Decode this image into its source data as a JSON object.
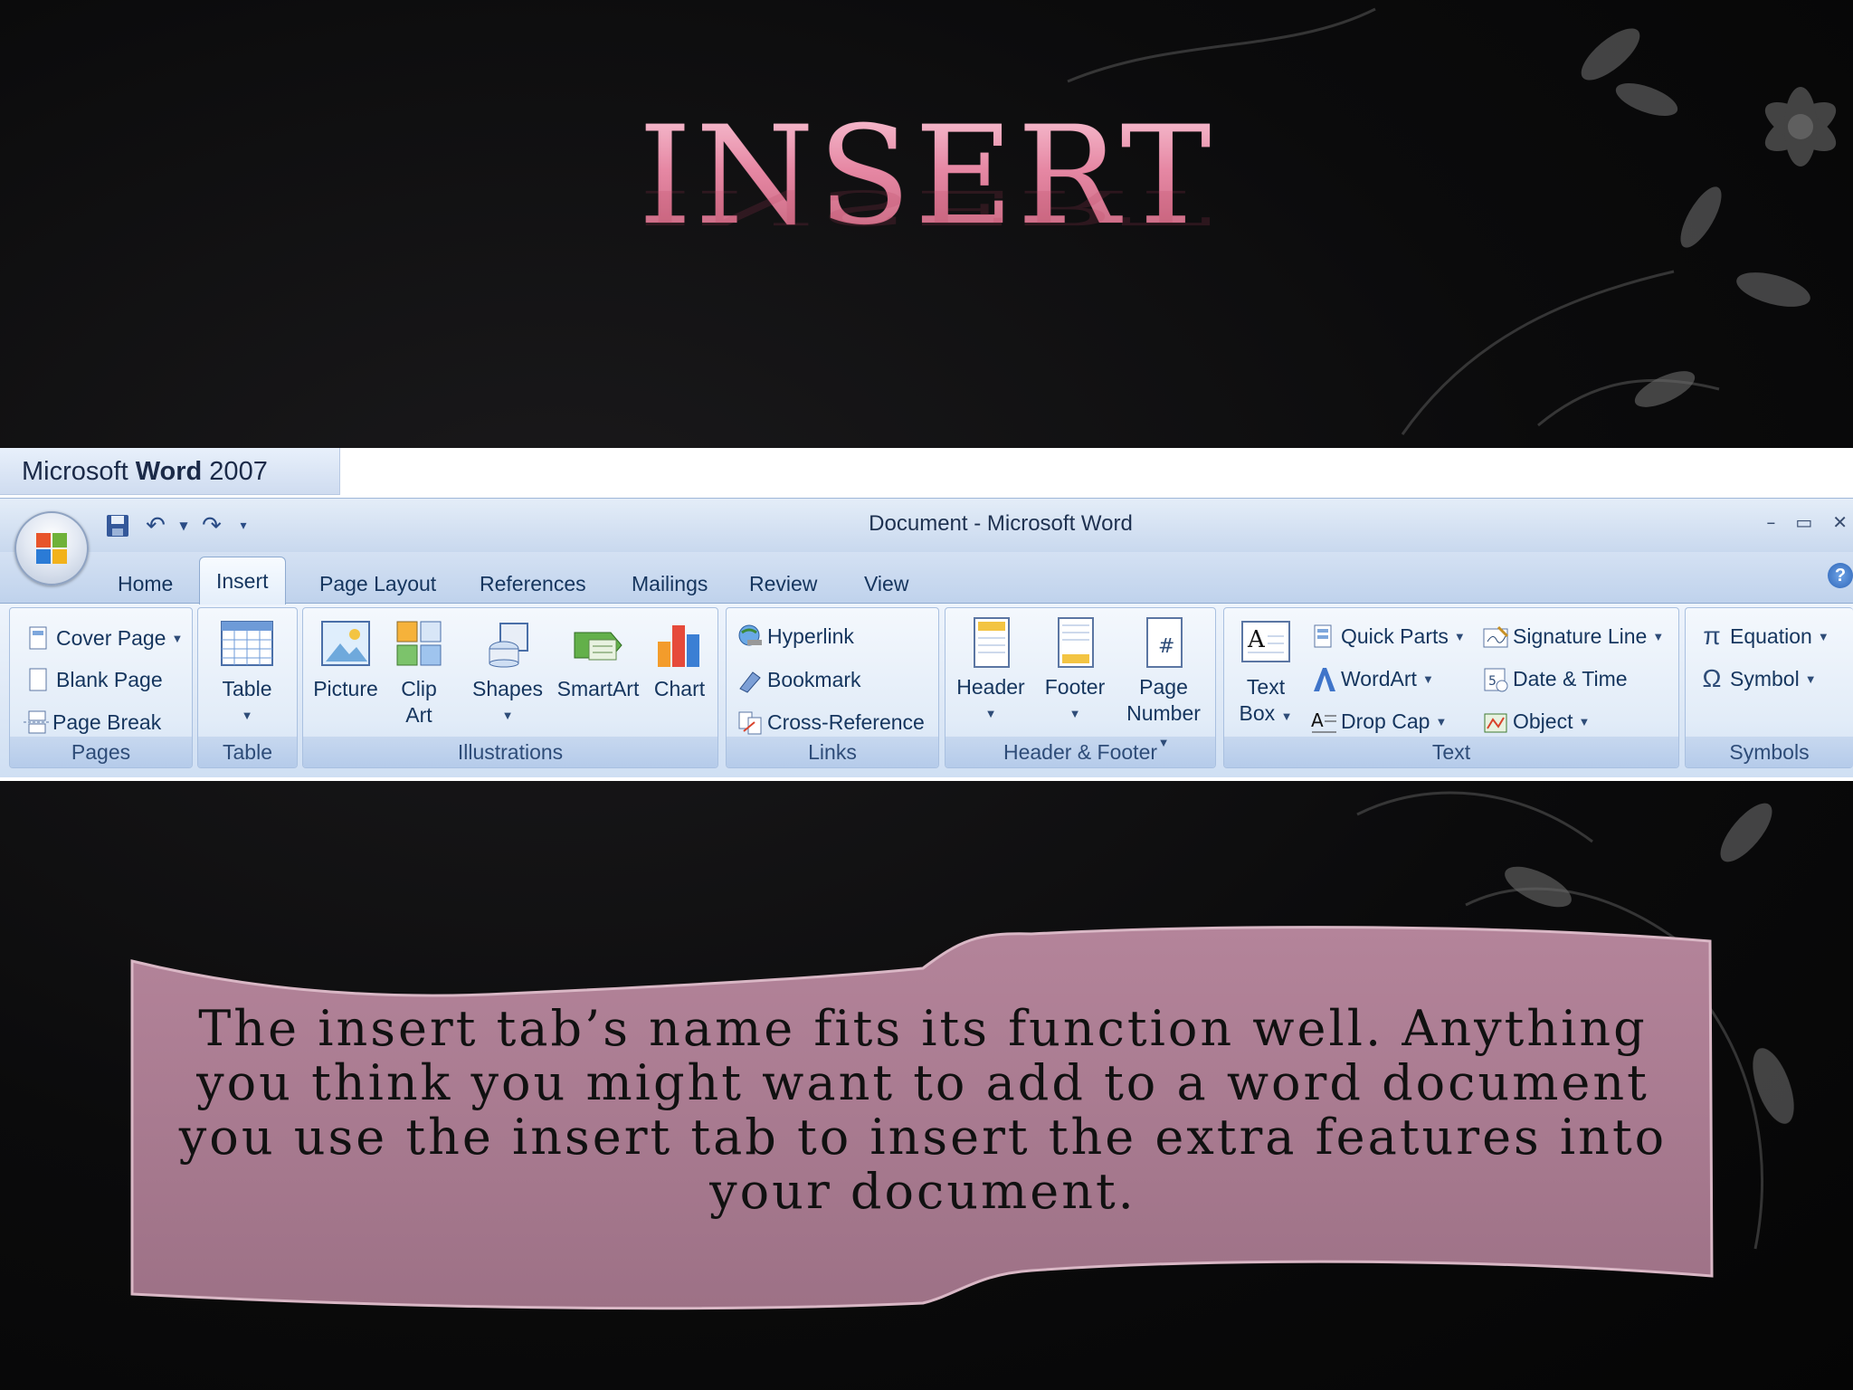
{
  "slide": {
    "title": "INSERT",
    "body_text": "The insert tab’s name fits its function well. Anything you think you might want to add to a word document you use the insert tab to insert the extra features into your document."
  },
  "screenshot": {
    "banner": {
      "prefix": "Microsoft ",
      "bold": "Word",
      "suffix": " 2007"
    },
    "window_title": "Document - Microsoft Word",
    "window_controls": [
      "–",
      "▭",
      "✕"
    ],
    "help_glyph": "?",
    "tabs": [
      "Home",
      "Insert",
      "Page Layout",
      "References",
      "Mailings",
      "Review",
      "View"
    ],
    "active_tab": "Insert",
    "groups": {
      "pages": {
        "label": "Pages",
        "items": [
          "Cover Page",
          "Blank Page",
          "Page Break"
        ]
      },
      "table": {
        "label": "Table",
        "items": [
          "Table"
        ]
      },
      "illustrations": {
        "label": "Illustrations",
        "items": [
          "Picture",
          "Clip Art",
          "Shapes",
          "SmartArt",
          "Chart"
        ]
      },
      "links": {
        "label": "Links",
        "items": [
          "Hyperlink",
          "Bookmark",
          "Cross-Reference"
        ]
      },
      "header_footer": {
        "label": "Header & Footer",
        "items": [
          "Header",
          "Footer",
          "Page Number"
        ]
      },
      "text": {
        "label": "Text",
        "items": [
          "Text Box",
          "Quick Parts",
          "WordArt",
          "Drop Cap",
          "Signature Line",
          "Date & Time",
          "Object"
        ]
      },
      "symbols": {
        "label": "Symbols",
        "items": [
          "Equation",
          "Symbol"
        ]
      }
    }
  },
  "colors": {
    "title_pink": "#e07a9a",
    "panel_mauve": "#a8788a",
    "ribbon_blue": "#dde8f6"
  }
}
